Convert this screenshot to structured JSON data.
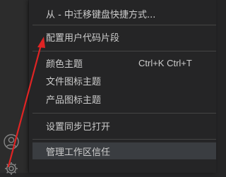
{
  "activity_bar": {
    "icons": [
      {
        "name": "account-icon"
      },
      {
        "name": "manage-gear-icon"
      }
    ]
  },
  "menu": {
    "items": [
      {
        "label": "从 - 中迁移键盘快捷方式..."
      },
      {
        "label": "配置用户代码片段"
      },
      {
        "label": "颜色主题",
        "shortcut": "Ctrl+K Ctrl+T"
      },
      {
        "label": "文件图标主题"
      },
      {
        "label": "产品图标主题"
      },
      {
        "label": "设置同步已打开"
      },
      {
        "label": "管理工作区信任"
      }
    ]
  },
  "annotation": {
    "color": "#e02424",
    "type": "arrow"
  }
}
